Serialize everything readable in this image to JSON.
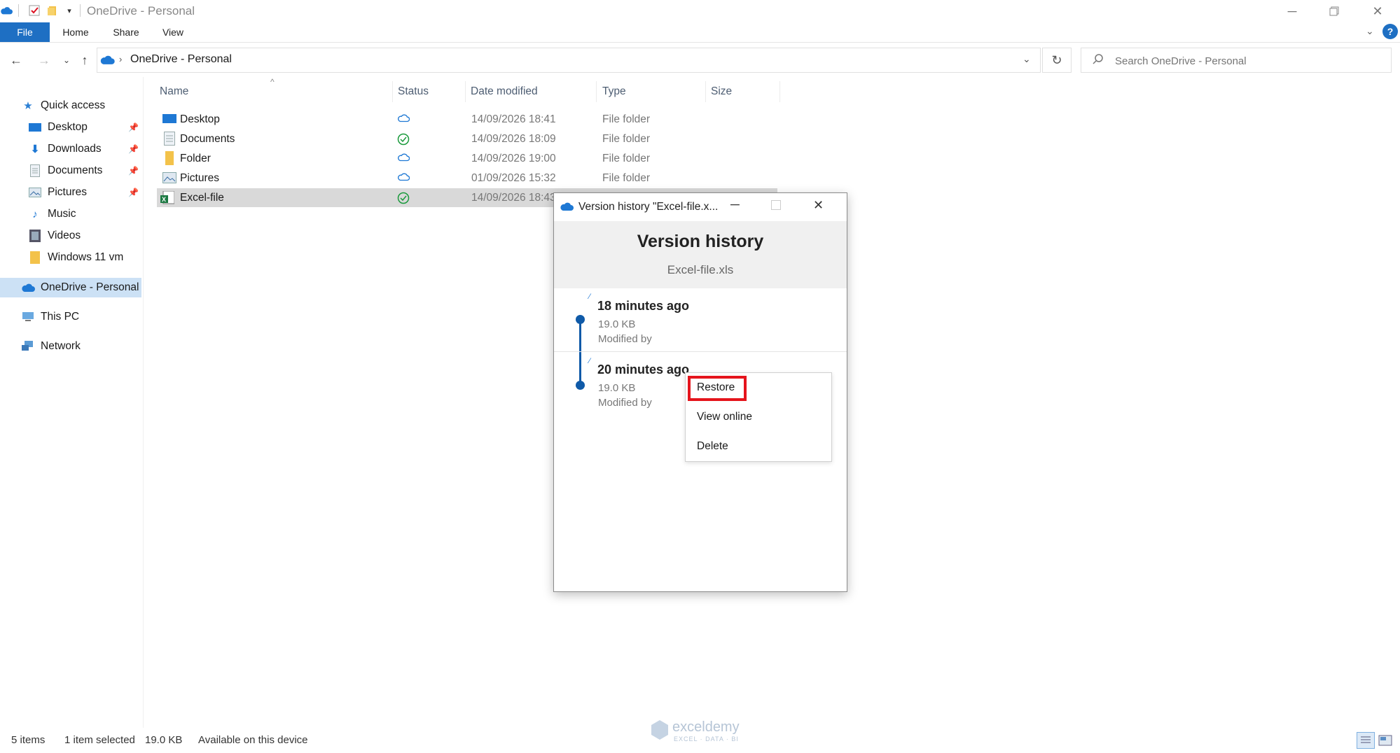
{
  "window": {
    "title": "OneDrive - Personal"
  },
  "ribbon": {
    "tabs": [
      "File",
      "Home",
      "Share",
      "View"
    ]
  },
  "address": {
    "path": "OneDrive - Personal"
  },
  "search": {
    "placeholder": "Search OneDrive - Personal"
  },
  "nav": {
    "quick_access": "Quick access",
    "items": [
      {
        "label": "Desktop",
        "icon": "desktop-icon",
        "pinned": true
      },
      {
        "label": "Downloads",
        "icon": "download-icon",
        "pinned": true
      },
      {
        "label": "Documents",
        "icon": "document-icon",
        "pinned": true
      },
      {
        "label": "Pictures",
        "icon": "pictures-icon",
        "pinned": true
      },
      {
        "label": "Music",
        "icon": "music-icon",
        "pinned": false
      },
      {
        "label": "Videos",
        "icon": "video-icon",
        "pinned": false
      },
      {
        "label": "Windows 11 vm",
        "icon": "folder-icon",
        "pinned": false
      }
    ],
    "onedrive": "OneDrive - Personal",
    "this_pc": "This PC",
    "network": "Network"
  },
  "columns": {
    "name": "Name",
    "status": "Status",
    "date": "Date modified",
    "type": "Type",
    "size": "Size"
  },
  "files": [
    {
      "name": "Desktop",
      "status": "cloud-icon",
      "date": "14/09/2026 18:41",
      "type": "File folder"
    },
    {
      "name": "Documents",
      "status": "check-icon",
      "date": "14/09/2026 18:09",
      "type": "File folder"
    },
    {
      "name": "Folder",
      "status": "cloud-icon",
      "date": "14/09/2026 19:00",
      "type": "File folder"
    },
    {
      "name": "Pictures",
      "status": "cloud-icon",
      "date": "01/09/2026 15:32",
      "type": "File folder"
    },
    {
      "name": "Excel-file",
      "status": "check-icon",
      "date": "14/09/2026 18:43",
      "type": ""
    }
  ],
  "version_history": {
    "window_title": "Version history \"Excel-file.x...",
    "heading": "Version history",
    "filename": "Excel-file.xls",
    "versions": [
      {
        "time": "18 minutes ago",
        "size": "19.0 KB",
        "modified": "Modified by"
      },
      {
        "time": "20 minutes ago",
        "size": "19.0 KB",
        "modified": "Modified by"
      }
    ],
    "context_menu": [
      "Restore",
      "View online",
      "Delete"
    ]
  },
  "statusbar": {
    "items": "5 items",
    "selected": "1 item selected",
    "size": "19.0 KB",
    "availability": "Available on this device"
  },
  "watermark": {
    "brand": "exceldemy",
    "tagline": "EXCEL · DATA · BI"
  },
  "colors": {
    "accent": "#1e6fc3",
    "highlight": "#e5141c",
    "selection": "#d9d9d9",
    "nav_selected": "#cce1f5"
  }
}
